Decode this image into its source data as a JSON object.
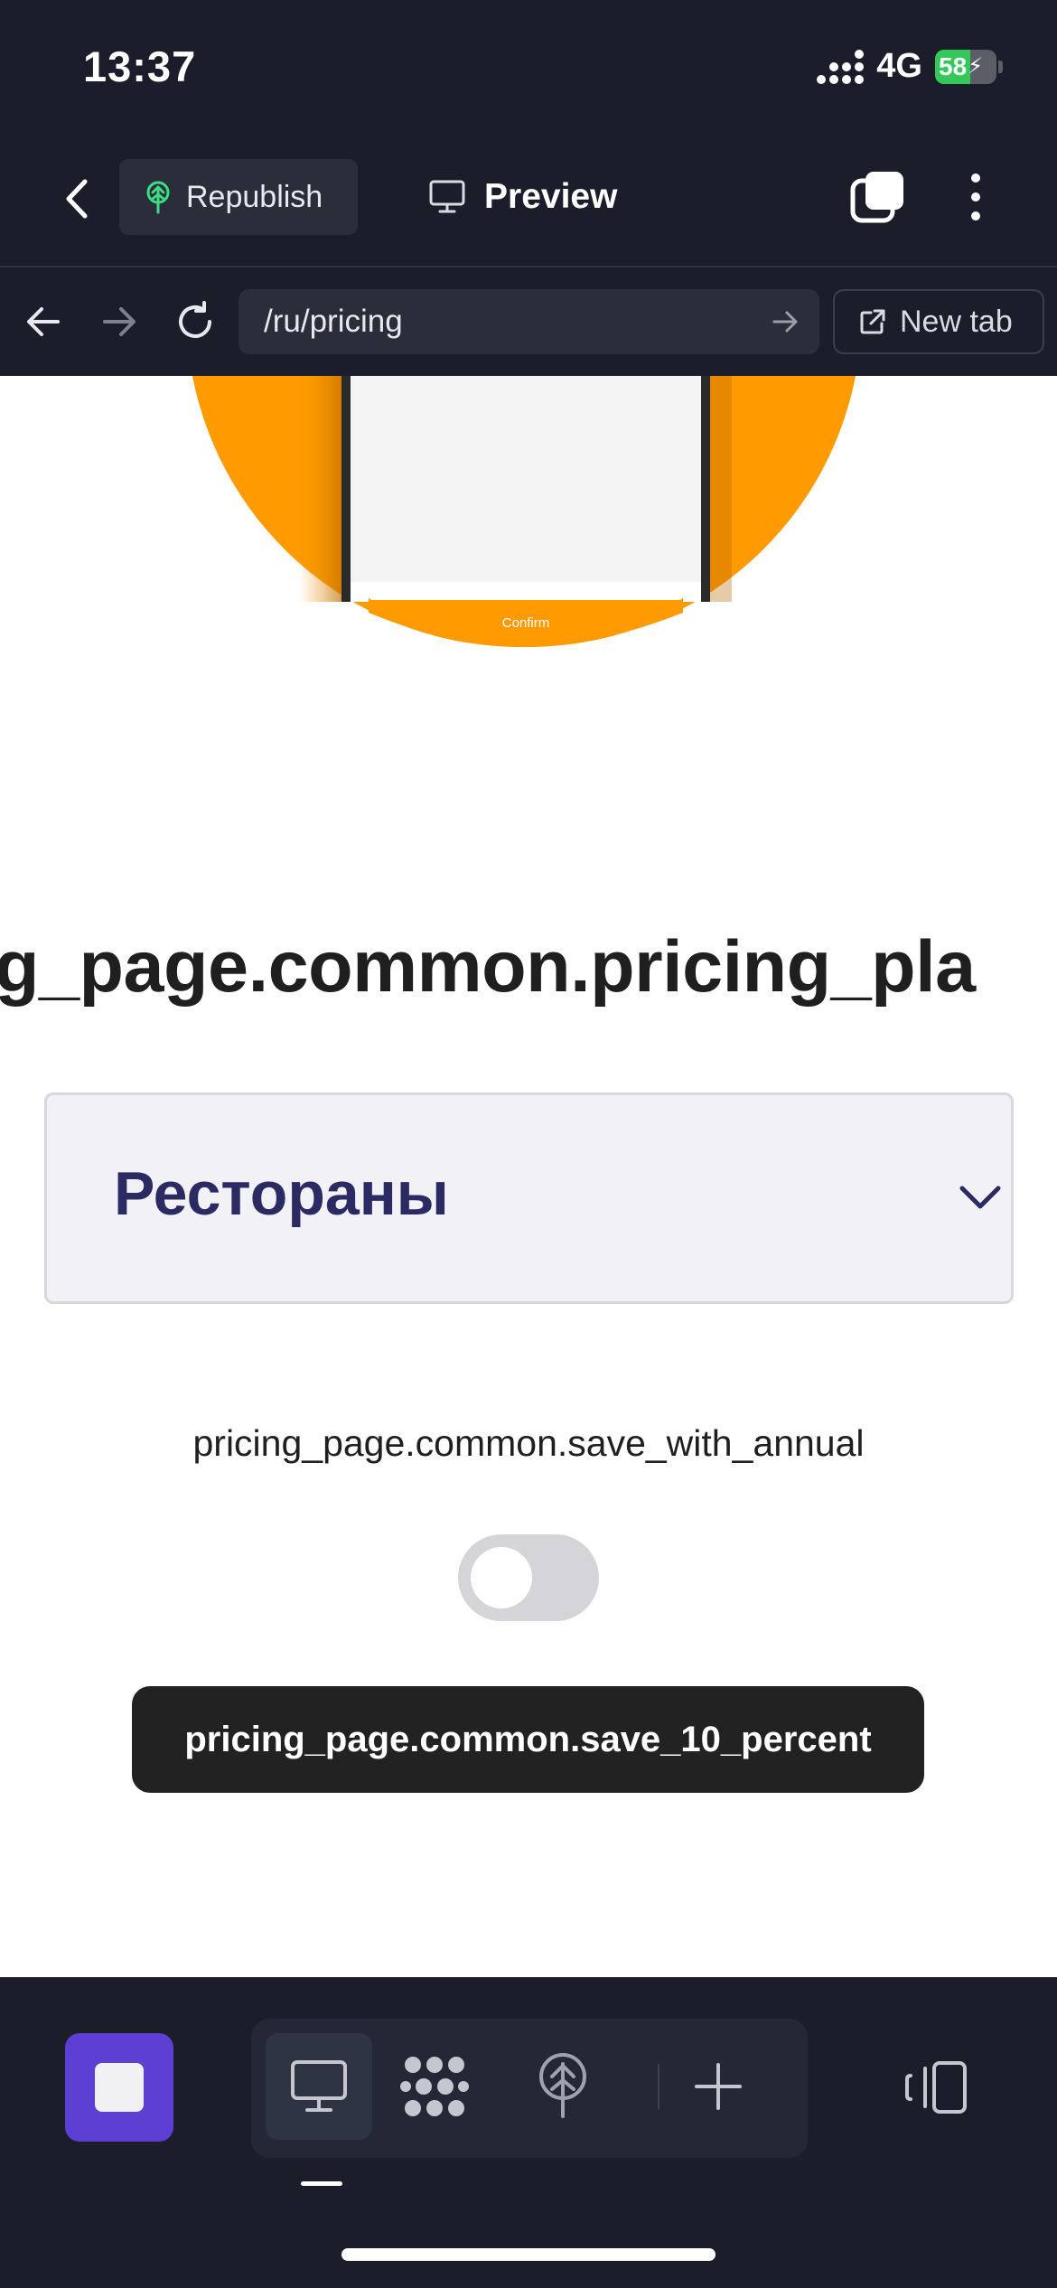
{
  "status_bar": {
    "time": "13:37",
    "network": "4G",
    "battery_percent": "58",
    "battery_level": 0.58
  },
  "editor_toolbar": {
    "republish_label": "Republish",
    "preview_label": "Preview"
  },
  "address_bar": {
    "url": "/ru/pricing",
    "new_tab_label": "New tab"
  },
  "page": {
    "hero_button_label": "Confirm",
    "pricing_heading": "g_page.common.pricing_pla",
    "category_select_value": "Рестораны",
    "annual_label": "pricing_page.common.save_with_annual",
    "annual_toggle_on": false,
    "save_badge": "pricing_page.common.save_10_percent"
  },
  "bottom_toolbar": {
    "icons": [
      "stop-icon",
      "desktop-icon",
      "components-icon",
      "publish-icon",
      "plus-icon",
      "panel-icon"
    ]
  },
  "colors": {
    "chrome_bg": "#1b1e2a",
    "accent_purple": "#5d3fd3",
    "hero_orange": "#ff9a00",
    "select_text": "#2b2a62",
    "battery_green": "#34c759"
  }
}
